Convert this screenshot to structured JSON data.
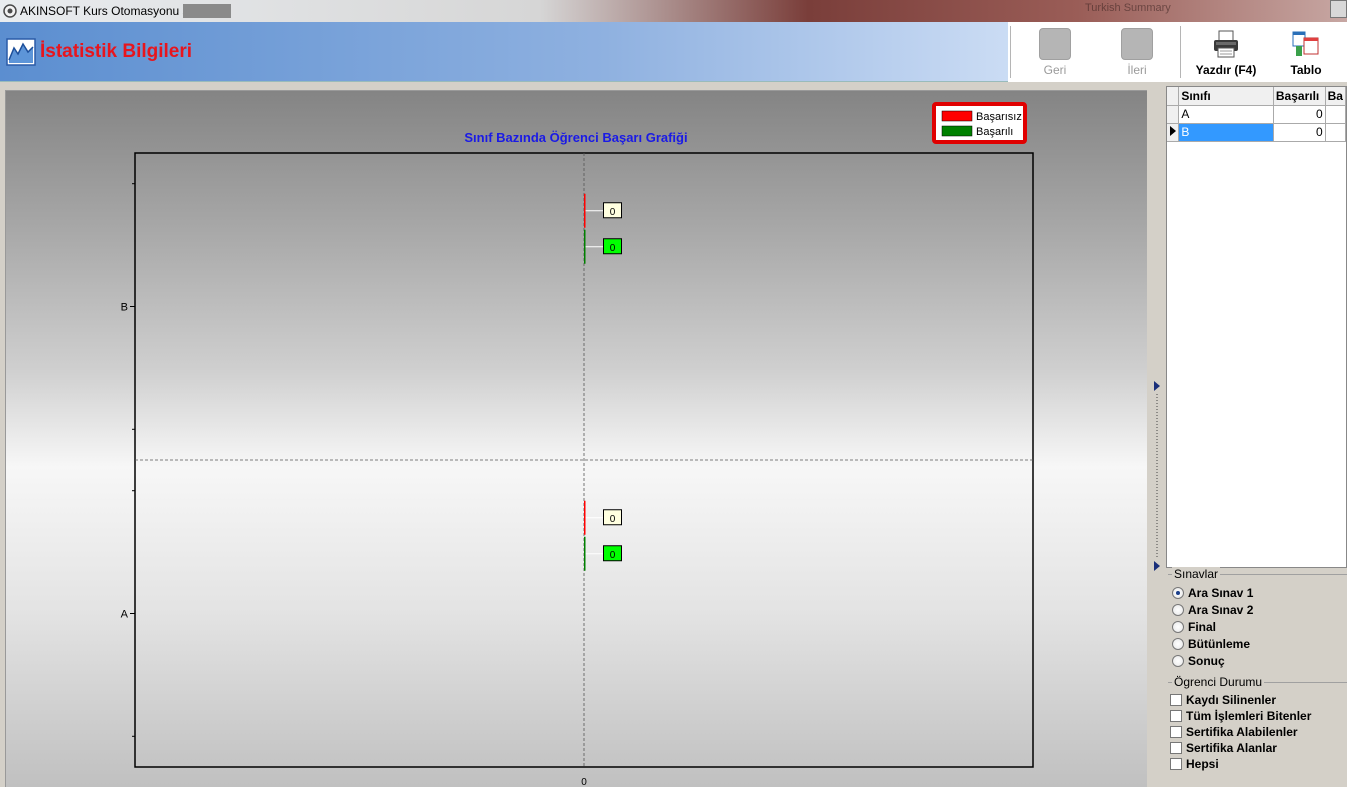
{
  "window": {
    "title": "AKINSOFT Kurs Otomasyonu s",
    "right_text": "Turkish Summary"
  },
  "header": {
    "page_title": "İstatistik Bilgileri"
  },
  "toolbar": {
    "geri_label": "Geri",
    "ileri_label": "İleri",
    "yazdir_label": "Yazdır (F4)",
    "tablo_label": "Tablo"
  },
  "chart_data": {
    "type": "bar",
    "orientation": "horizontal",
    "title": "Sınıf Bazında Öğrenci Başarı Grafiği",
    "categories": [
      "A",
      "B"
    ],
    "series": [
      {
        "name": "Başarısız",
        "values": [
          0,
          0
        ],
        "color": "#ff0000",
        "label_bg": "#ffffe0"
      },
      {
        "name": "Başarılı",
        "values": [
          0,
          0
        ],
        "color": "#008000",
        "label_bg": "#00ff00"
      }
    ],
    "x_tick_labels": [
      "0"
    ],
    "legend_position": "top-right",
    "grid": true
  },
  "grid": {
    "columns": [
      "Sınıfı",
      "Başarılı",
      "Ba"
    ],
    "rows": [
      {
        "sinifi": "A",
        "basarili": "0"
      },
      {
        "sinifi": "B",
        "basarili": "0"
      }
    ],
    "selected_row": 1
  },
  "sinavlar": {
    "title": "Sınavlar",
    "options": [
      "Ara Sınav 1",
      "Ara Sınav 2",
      "Final",
      "Bütünleme",
      "Sonuç"
    ],
    "selected": 0
  },
  "ogrenci_durumu": {
    "title": "Ögrenci Durumu",
    "options": [
      "Kaydı Silinenler",
      "Tüm İşlemleri Bitenler",
      "Sertifika Alabilenler",
      "Sertifika Alanlar",
      "Hepsi"
    ]
  }
}
